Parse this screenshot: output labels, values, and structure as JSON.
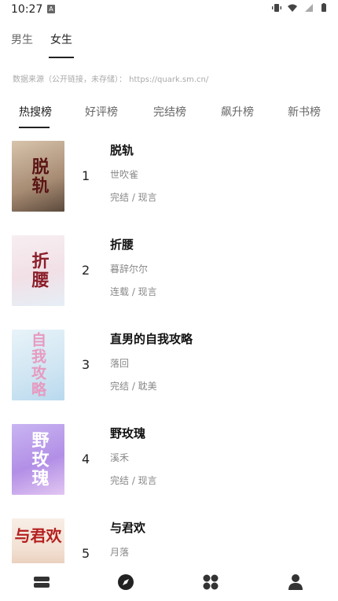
{
  "status": {
    "time": "10:27",
    "a_badge": "A",
    "icons": [
      "vibrate-icon",
      "wifi-icon",
      "signal-icon",
      "battery-icon"
    ]
  },
  "gender_tabs": [
    {
      "label": "男生",
      "active": false
    },
    {
      "label": "女生",
      "active": true
    }
  ],
  "source_note": "数据来源（公开链接，未存储）： https://quark.sm.cn/",
  "rank_tabs": [
    {
      "label": "热搜榜",
      "active": true
    },
    {
      "label": "好评榜",
      "active": false
    },
    {
      "label": "完结榜",
      "active": false
    },
    {
      "label": "飙升榜",
      "active": false
    },
    {
      "label": "新书榜",
      "active": false
    }
  ],
  "books": [
    {
      "rank": "1",
      "title": "脱轨",
      "author": "世吹雀",
      "meta": "完结 / 现言",
      "cover_text": "脱轨",
      "cover_bg": "#b7a08a",
      "cover_fg": "#6a1b1b"
    },
    {
      "rank": "2",
      "title": "折腰",
      "author": "暮辞尔尔",
      "meta": "连载 / 现言",
      "cover_text": "折腰",
      "cover_bg": "#f3e6ea",
      "cover_fg": "#8b1f2a"
    },
    {
      "rank": "3",
      "title": "直男的自我攻略",
      "author": "落回",
      "meta": "完结 / 耽美",
      "cover_text": "自我攻略",
      "cover_bg": "#cfe6f2",
      "cover_fg": "#e8a3c4"
    },
    {
      "rank": "4",
      "title": "野玫瑰",
      "author": "溪禾",
      "meta": "完结 / 现言",
      "cover_text": "野玫瑰",
      "cover_bg": "#b799e6",
      "cover_fg": "#ffffff"
    },
    {
      "rank": "5",
      "title": "与君欢",
      "author": "月落",
      "meta": "",
      "cover_text": "与君欢",
      "cover_bg": "#f6e9df",
      "cover_fg": "#b41f1f"
    }
  ],
  "bottom_nav": [
    {
      "icon": "bookshelf-icon",
      "active": false
    },
    {
      "icon": "compass-icon",
      "active": true
    },
    {
      "icon": "category-grid-icon",
      "active": false
    },
    {
      "icon": "profile-icon",
      "active": false
    }
  ]
}
